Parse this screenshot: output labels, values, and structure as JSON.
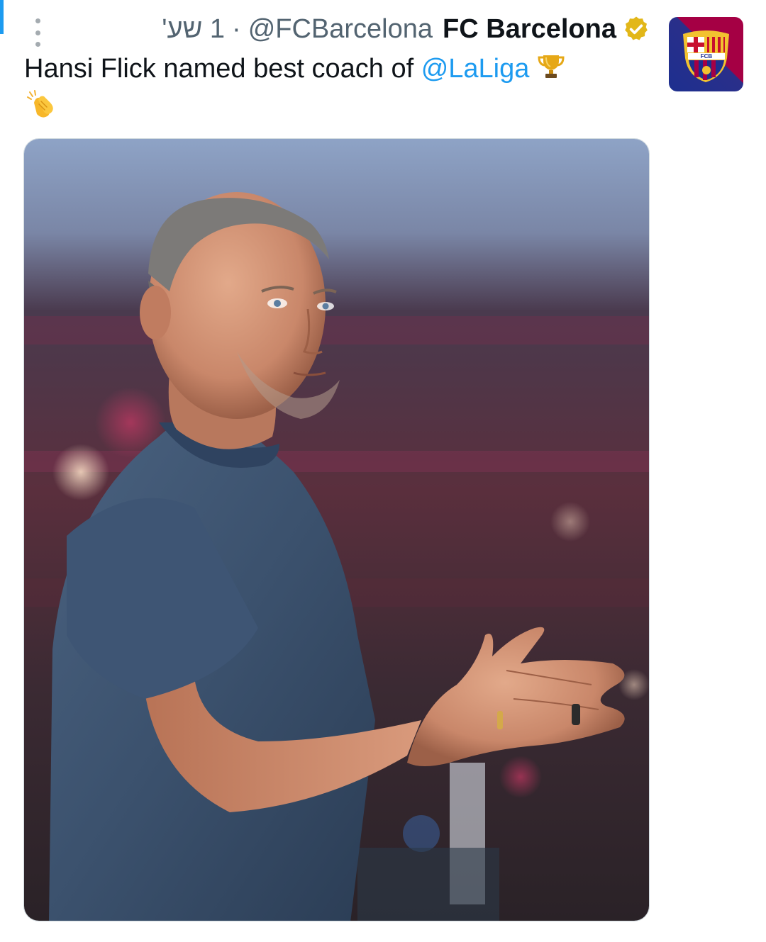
{
  "tweet": {
    "time": "1 שע'",
    "handle": "@FCBarcelona",
    "author_name": "FC Barcelona",
    "verified_badge": "gold-verified-icon",
    "text_main": "Hansi Flick named best coach of ",
    "mention": "@LaLiga",
    "emojis": [
      "trophy-icon",
      "clapping-hands-icon"
    ],
    "avatar": "fc-barcelona-crest",
    "avatar_lettering": "FCB",
    "media": "photo-coach-clapping-in-stadium"
  },
  "colors": {
    "accent": "#1d9bf0",
    "text": "#0f1419",
    "secondary_text": "#536471",
    "verified_gold": "#e2b719",
    "barca_blue": "#1d2f8f",
    "barca_red": "#a50044"
  }
}
